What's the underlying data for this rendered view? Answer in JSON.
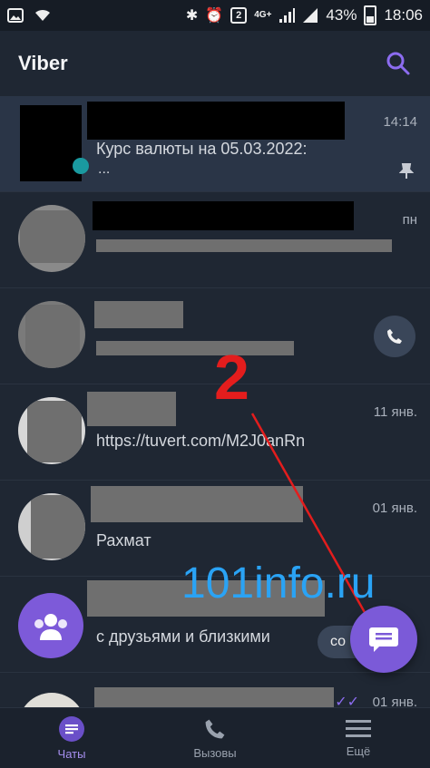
{
  "status_bar": {
    "signal_badge": "2",
    "network": "4G+",
    "battery": "43%",
    "time": "18:06"
  },
  "app": {
    "title": "Viber",
    "icons": {
      "search": "search-icon"
    }
  },
  "chats": [
    {
      "name": "",
      "message_line1": "Курс валюты на 05.03.2022:",
      "message_line2": "...",
      "time": "14:14",
      "pinned": true
    },
    {
      "name": "",
      "message_line1": "",
      "time": "пн"
    },
    {
      "name": "",
      "message_line1": "",
      "time": ""
    },
    {
      "name": "",
      "message_line1": "https://tuvert.com/M2J0anRn",
      "time": "11 янв."
    },
    {
      "name": "",
      "message_line1": "Рахмат",
      "time": "01 янв."
    },
    {
      "name": "",
      "message_line1": "с друзьями и близкими",
      "time": "",
      "create_label": "со"
    },
    {
      "name": "",
      "message_line1": "",
      "time": "01 янв."
    }
  ],
  "annotation": {
    "number": "2",
    "watermark": "101info.ru",
    "color": "#e31d1d",
    "watermark_color": "#2aa3f5"
  },
  "bottom_nav": [
    {
      "label": "Чаты",
      "icon": "chat-icon",
      "selected": true
    },
    {
      "label": "Вызовы",
      "icon": "phone-icon",
      "selected": false
    },
    {
      "label": "Ещё",
      "icon": "menu-icon",
      "selected": false
    }
  ],
  "colors": {
    "accent": "#7b5ad8",
    "background": "#1f2733",
    "active_row": "#2a3547"
  }
}
